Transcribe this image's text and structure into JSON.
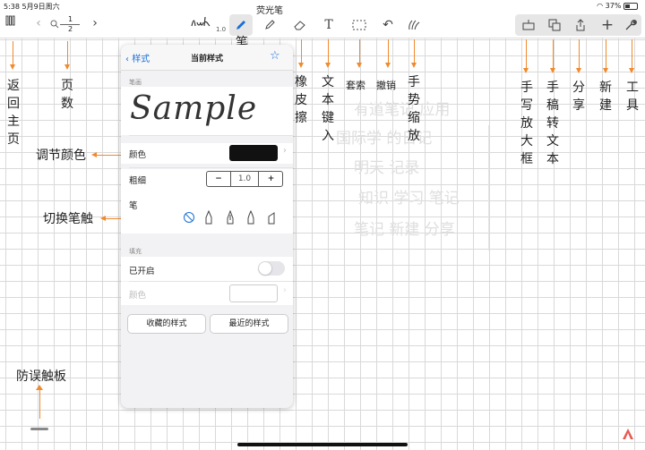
{
  "status_bar": {
    "time_date": "5:38  5月9日周六",
    "battery": "37%"
  },
  "toolbar": {
    "library_icon": "library-icon",
    "page_current": "1",
    "page_total": "2",
    "pen_size": "1.0",
    "pen_callout": "荧光笔",
    "pen_vertical_label": "笔工具"
  },
  "annotations": {
    "home": "返回主页",
    "pages": "页数",
    "eraser": "橡皮擦",
    "text_input": "文本键入",
    "lasso": "套索",
    "undo": "撤销",
    "gesture_zoom": "手势缩放",
    "zoom_box": "手写放大框",
    "to_text": "手稿转文本",
    "share": "分享",
    "new": "新建",
    "tools": "工具",
    "adjust_color": "调节颜色",
    "switch_nib": "切换笔触",
    "palm_rejection": "防误触板"
  },
  "popover": {
    "back_label": "样式",
    "title": "当前样式",
    "pen_section": "笔画",
    "sample_text": "Sample",
    "color_label": "颜色",
    "color_value": "#111111",
    "thickness_label": "粗细",
    "thickness_minus": "−",
    "thickness_value": "1.0",
    "thickness_plus": "+",
    "nib_label": "笔",
    "fill_section": "填充",
    "fill_enabled_label": "已开启",
    "fill_color_label": "颜色",
    "fill_enabled": false,
    "saved_styles": "收藏的样式",
    "recent_styles": "最近的样式"
  },
  "canvas_bg_text": {
    "line1": "有道笔记 应用",
    "line2": "国际学 的日记",
    "line3": "明天 记录",
    "line4": "知识 学习 笔记",
    "line5": "笔记 新建 分享"
  },
  "colors": {
    "accent": "#1a6fd8",
    "arrow": "#f08a2c",
    "logo": "#e8584f"
  }
}
